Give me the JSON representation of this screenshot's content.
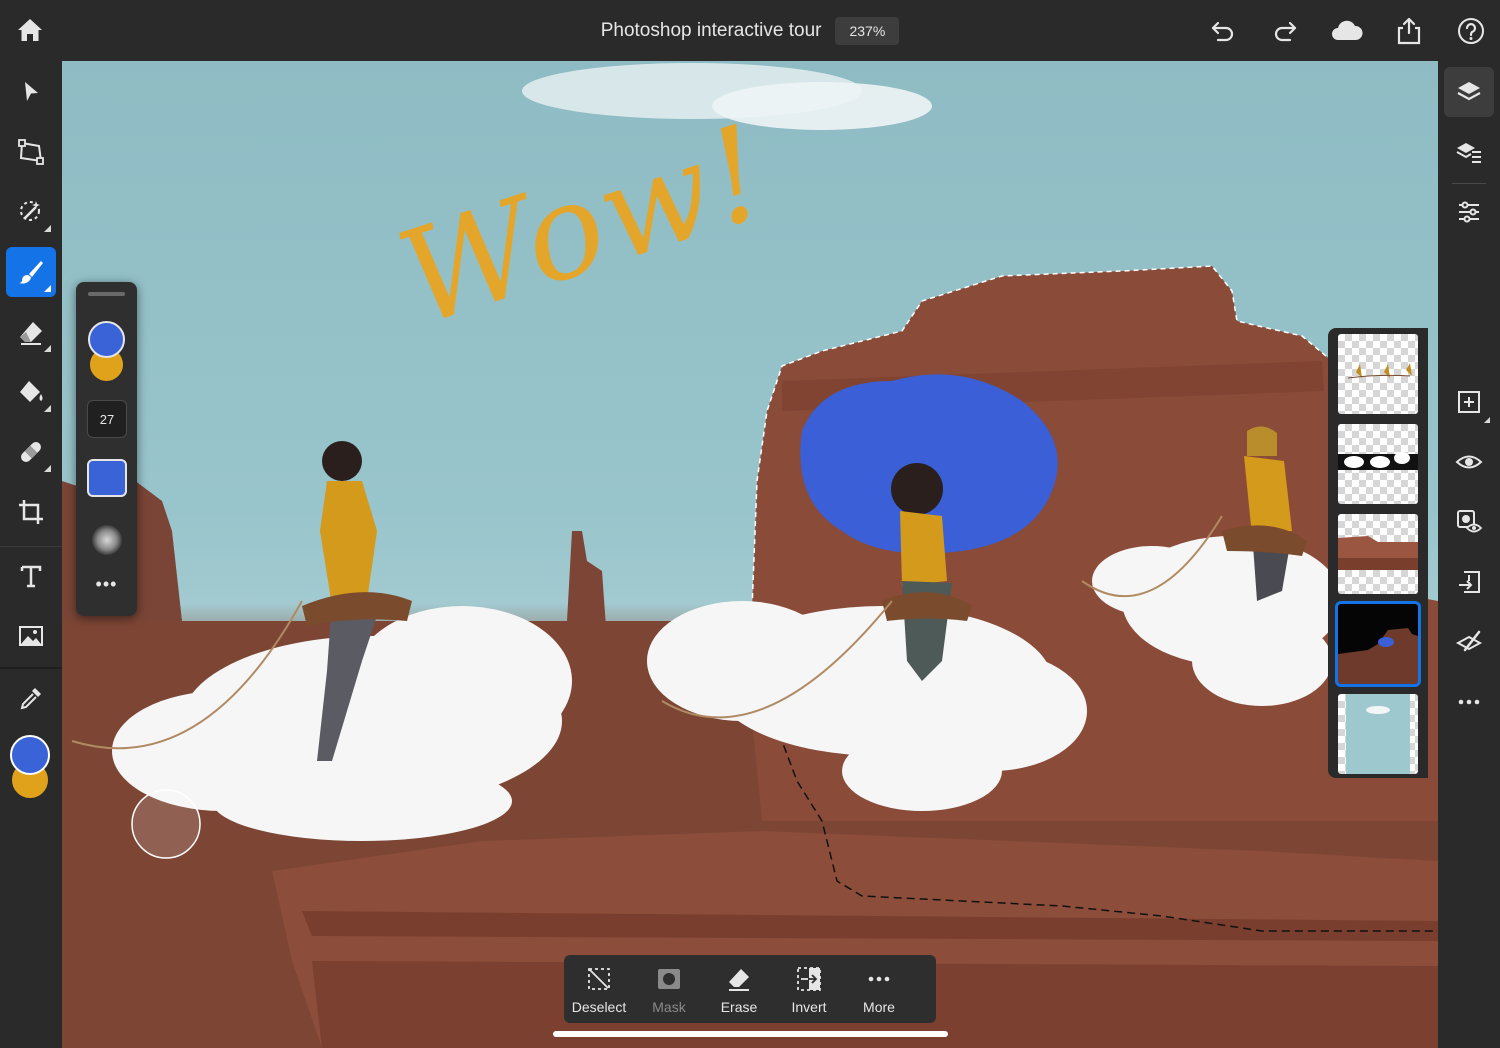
{
  "app": {
    "document_title": "Photoshop interactive tour",
    "zoom": "237%"
  },
  "colors": {
    "accent": "#1473e6",
    "primary_color": "#3a63d8",
    "secondary_color": "#e0a21a",
    "toolbar_bg": "#2a2a2a"
  },
  "top_actions": [
    "undo-icon",
    "redo-icon",
    "cloud-icon",
    "share-icon",
    "help-icon"
  ],
  "left_tools": [
    {
      "name": "move-tool",
      "icon": "arrow-icon"
    },
    {
      "name": "transform-tool",
      "icon": "transform-icon"
    },
    {
      "name": "selection-tool",
      "icon": "magic-select-icon"
    },
    {
      "name": "brush-tool",
      "icon": "brush-icon",
      "active": true
    },
    {
      "name": "eraser-tool",
      "icon": "eraser-icon"
    },
    {
      "name": "fill-tool",
      "icon": "paint-bucket-icon"
    },
    {
      "name": "healing-tool",
      "icon": "bandage-icon"
    },
    {
      "name": "crop-tool",
      "icon": "crop-icon"
    },
    {
      "name": "type-tool",
      "icon": "type-icon"
    },
    {
      "name": "place-image-tool",
      "icon": "image-icon"
    },
    {
      "name": "eyedropper-tool",
      "icon": "eyedropper-icon"
    }
  ],
  "brush_panel": {
    "size": "27",
    "more_label": "•••"
  },
  "canvas": {
    "annotation_text": "Wow!"
  },
  "right_tools": [
    "layers-icon",
    "layer-properties-icon",
    "adjustments-icon",
    "add-layer-icon",
    "visibility-icon",
    "mask-visibility-icon",
    "import-icon",
    "effects-icon",
    "more-icon"
  ],
  "layers": [
    {
      "name": "layer-riders"
    },
    {
      "name": "layer-clouds-mask"
    },
    {
      "name": "layer-rocks"
    },
    {
      "name": "layer-selection-mask",
      "selected": true
    },
    {
      "name": "layer-sky"
    }
  ],
  "action_bar": [
    {
      "label": "Deselect",
      "icon": "deselect-icon",
      "enabled": true
    },
    {
      "label": "Mask",
      "icon": "mask-icon",
      "enabled": false
    },
    {
      "label": "Erase",
      "icon": "erase-icon",
      "enabled": true
    },
    {
      "label": "Invert",
      "icon": "invert-icon",
      "enabled": true
    },
    {
      "label": "More",
      "icon": "more-icon",
      "enabled": true
    }
  ]
}
